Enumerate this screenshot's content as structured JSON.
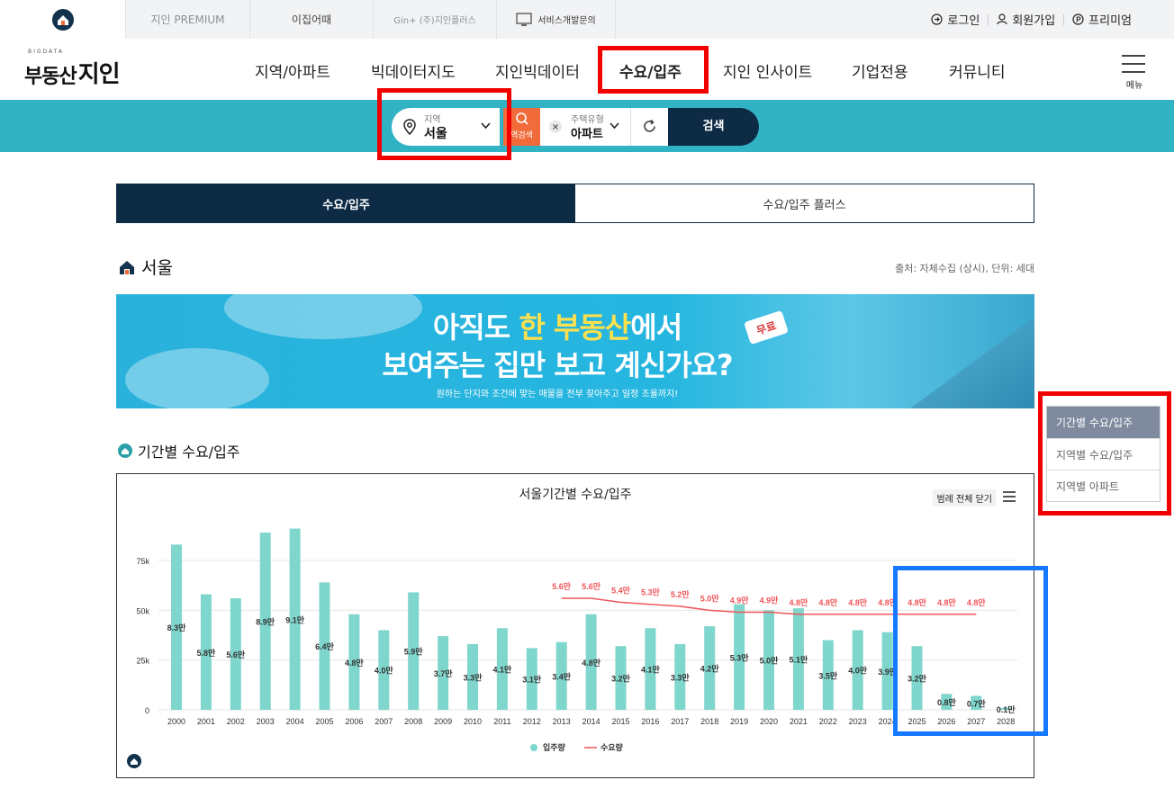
{
  "topbar": {
    "tabs": [
      {
        "label": "",
        "icon": "home-logo-icon"
      },
      {
        "label": "지인 PREMIUM"
      },
      {
        "label": "이집어때"
      },
      {
        "label": "Gin+ (주)지인플러스"
      },
      {
        "label": "서비스개발문의",
        "icon": "monitor-icon"
      }
    ],
    "login": "로그인",
    "signup": "회원가입",
    "premium": "프리미엄"
  },
  "logo": {
    "small": "BIGDATA",
    "kor": "부동산",
    "big": "지인"
  },
  "nav": {
    "items": [
      "지역/아파트",
      "빅데이터지도",
      "지인빅데이터",
      "수요/입주",
      "지인 인사이트",
      "기업전용",
      "커뮤니티"
    ],
    "active_index": 3,
    "menu_label": "메뉴"
  },
  "search": {
    "region_label": "지역",
    "region_value": "서울",
    "reverse_search": "역검색",
    "htype_label": "주택유형",
    "htype_value": "아파트",
    "search_button": "검색"
  },
  "tabs": [
    "수요/입주",
    "수요/입주 플러스"
  ],
  "section": {
    "title": "서울",
    "source": "출처: 자체수집 (상시), 단위: 세대"
  },
  "banner": {
    "line1_a": "아직도 ",
    "line1_hl1": "한",
    "line1_hl2": "부동산",
    "line1_b": "에서",
    "line2": "보여주는 집만 보고 계신가요?",
    "line3": "원하는 단지와 조건에 맞는 매물을 전부 찾아주고 일정 조율까지!",
    "badge": "무료"
  },
  "subsection": {
    "title": "기간별 수요/입주"
  },
  "chart_controls": {
    "legend_close": "범례 전체 닫기"
  },
  "side_menu": [
    "기간별 수요/입주",
    "지역별 수요/입주",
    "지역별 아파트"
  ],
  "colors": {
    "accent_teal": "#31b3c4",
    "navy": "#0d2b45",
    "bar": "#7fd6cc",
    "line": "#f0555a",
    "highlight_red": "#f20000",
    "highlight_blue": "#1479ff"
  },
  "chart_data": {
    "type": "bar",
    "title": "서울기간별 수요/입주",
    "categories": [
      "2000",
      "2001",
      "2002",
      "2003",
      "2004",
      "2005",
      "2006",
      "2007",
      "2008",
      "2009",
      "2010",
      "2011",
      "2012",
      "2013",
      "2014",
      "2015",
      "2016",
      "2017",
      "2018",
      "2019",
      "2020",
      "2021",
      "2022",
      "2023",
      "2024",
      "2025",
      "2026",
      "2027",
      "2028"
    ],
    "series": [
      {
        "name": "입주량",
        "type": "bar",
        "values": [
          83000,
          58000,
          56000,
          89000,
          91000,
          64000,
          48000,
          40000,
          59000,
          37000,
          33000,
          41000,
          31000,
          34000,
          48000,
          32000,
          41000,
          33000,
          42000,
          53000,
          50000,
          51000,
          35000,
          40000,
          39000,
          32000,
          8000,
          7000,
          1000
        ],
        "labels": [
          "8.3만",
          "5.8만",
          "5.6만",
          "8.9만",
          "9.1만",
          "6.4만",
          "4.8만",
          "4.0만",
          "5.9만",
          "3.7만",
          "3.3만",
          "4.1만",
          "3.1만",
          "3.4만",
          "4.8만",
          "3.2만",
          "4.1만",
          "3.3만",
          "4.2만",
          "5.3만",
          "5.0만",
          "5.1만",
          "3.5만",
          "4.0만",
          "3.9만",
          "3.2만",
          "0.8만",
          "0.7만",
          "0.1만"
        ]
      },
      {
        "name": "수요량",
        "type": "line",
        "start_index": 13,
        "values": [
          56000,
          56000,
          54000,
          53000,
          52000,
          50000,
          49000,
          49000,
          48000,
          48000,
          48000,
          48000,
          48000,
          48000,
          48000
        ],
        "labels": [
          "5.6만",
          "5.6만",
          "5.4만",
          "5.3만",
          "5.2만",
          "5.0만",
          "4.9만",
          "4.9만",
          "4.8만",
          "4.8만",
          "4.8만",
          "4.8만",
          "4.8만",
          "4.8만",
          "4.8만"
        ]
      }
    ],
    "ylim": [
      0,
      100000
    ],
    "yticks": [
      "0",
      "25k",
      "50k",
      "75k"
    ],
    "ytick_values": [
      0,
      25000,
      50000,
      75000
    ],
    "legend_position": "bottom-center",
    "grid": true
  }
}
